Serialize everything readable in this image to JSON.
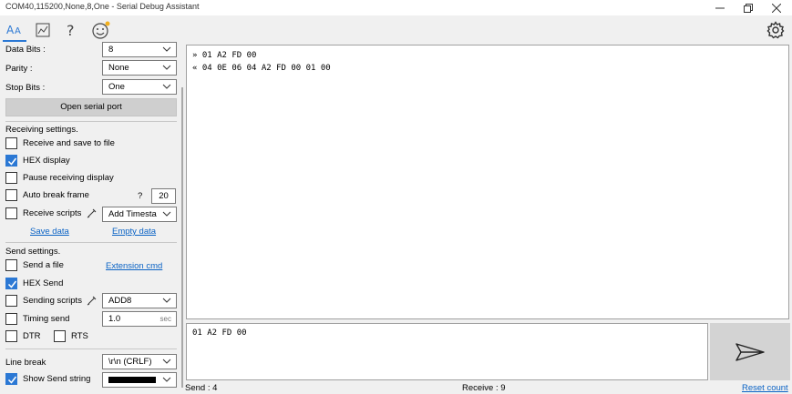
{
  "window": {
    "title": "COM40,115200,None,8,One - Serial Debug Assistant",
    "controls": [
      "minimize",
      "restore",
      "close"
    ]
  },
  "toolbar": {
    "items": [
      {
        "name": "text-mode",
        "icon": "font-aa-icon",
        "active": true
      },
      {
        "name": "chart",
        "icon": "chart-icon",
        "active": false
      },
      {
        "name": "help",
        "icon": "question-icon",
        "active": false
      },
      {
        "name": "feedback",
        "icon": "smiley-icon",
        "active": false
      }
    ],
    "settings_icon": "gear-icon"
  },
  "serial": {
    "data_bits_label": "Data Bits :",
    "data_bits_value": "8",
    "parity_label": "Parity :",
    "parity_value": "None",
    "stop_bits_label": "Stop Bits :",
    "stop_bits_value": "One",
    "open_button": "Open serial port"
  },
  "receiving": {
    "heading": "Receiving settings.",
    "receive_save_file": {
      "label": "Receive and save to file",
      "checked": false
    },
    "hex_display": {
      "label": "HEX display",
      "checked": true
    },
    "pause_display": {
      "label": "Pause receiving display",
      "checked": false
    },
    "auto_break": {
      "label": "Auto break frame",
      "checked": false,
      "help": "?",
      "value": "20"
    },
    "receive_scripts": {
      "label": "Receive scripts",
      "checked": false,
      "select": "Add Timesta"
    },
    "save_data_link": "Save data",
    "empty_data_link": "Empty data"
  },
  "sending": {
    "heading": "Send settings.",
    "send_file": {
      "label": "Send a file",
      "checked": false
    },
    "extension_link": "Extension cmd",
    "hex_send": {
      "label": "HEX Send",
      "checked": true
    },
    "sending_scripts": {
      "label": "Sending scripts",
      "checked": false,
      "select": "ADD8"
    },
    "timing_send": {
      "label": "Timing send",
      "checked": false,
      "value": "1.0",
      "unit": "sec"
    },
    "dtr": {
      "label": "DTR",
      "checked": false
    },
    "rts": {
      "label": "RTS",
      "checked": false
    },
    "line_break_label": "Line break",
    "line_break_value": "\\r\\n (CRLF)",
    "show_send_string": {
      "label": "Show Send string",
      "checked": true,
      "color": "#000000"
    }
  },
  "terminal": {
    "lines": [
      "» 01 A2 FD 00",
      "« 04 0E 06 04 A2 FD 00 01 00"
    ]
  },
  "send_input": {
    "value": "01 A2 FD 00"
  },
  "status": {
    "send": "Send : 4",
    "receive": "Receive : 9",
    "reset": "Reset count"
  },
  "colors": {
    "accent": "#2b78d4",
    "link": "#0b63c5"
  }
}
